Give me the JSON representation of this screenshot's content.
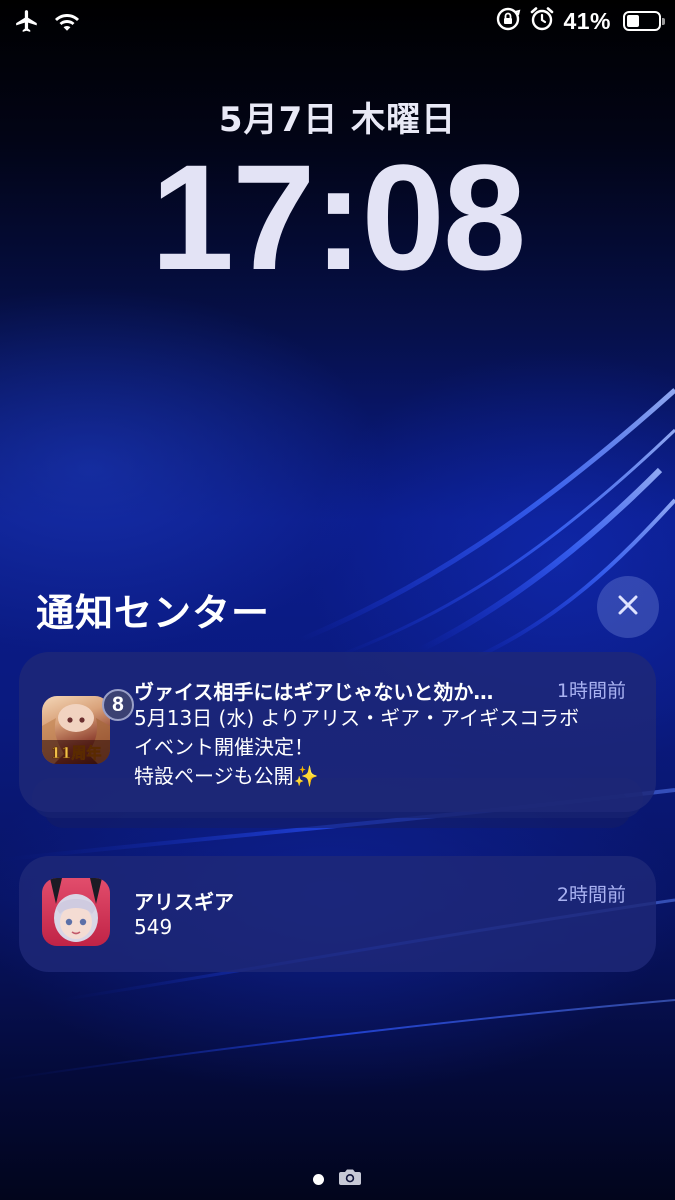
{
  "status_bar": {
    "left_icons": [
      "airplane-icon",
      "wifi-icon"
    ],
    "right_icons": [
      "rotation-lock-icon",
      "alarm-icon",
      "battery-icon"
    ],
    "battery_percent": "41%",
    "battery_level": 0.41
  },
  "lock_screen": {
    "date": "5月7日 木曜日",
    "time": "17:08"
  },
  "notification_center": {
    "title": "通知センター",
    "close_icon": "close-icon"
  },
  "notifications": [
    {
      "app_icon": "game-app-icon-11th-anniversary",
      "badge_count": "8",
      "title": "ヴァイス相手にはギアじゃないと効か…",
      "time": "1時間前",
      "body_lines": [
        "5月13日 (水) よりアリス・ギア・アイギスコラボ",
        "イベント開催決定！",
        "特設ページも公開✨"
      ],
      "stacked": true
    },
    {
      "app_icon": "alice-gear-app-icon",
      "title": "アリスギア",
      "time": "2時間前",
      "body_lines": [
        "549"
      ]
    }
  ],
  "page_indicator": {
    "pages": 2,
    "current": 1,
    "camera_icon": "camera-icon"
  },
  "colors": {
    "notification_bg": "#1e2878",
    "time_accent": "#a9b2f2",
    "lock_text": "#e3e3f5"
  }
}
